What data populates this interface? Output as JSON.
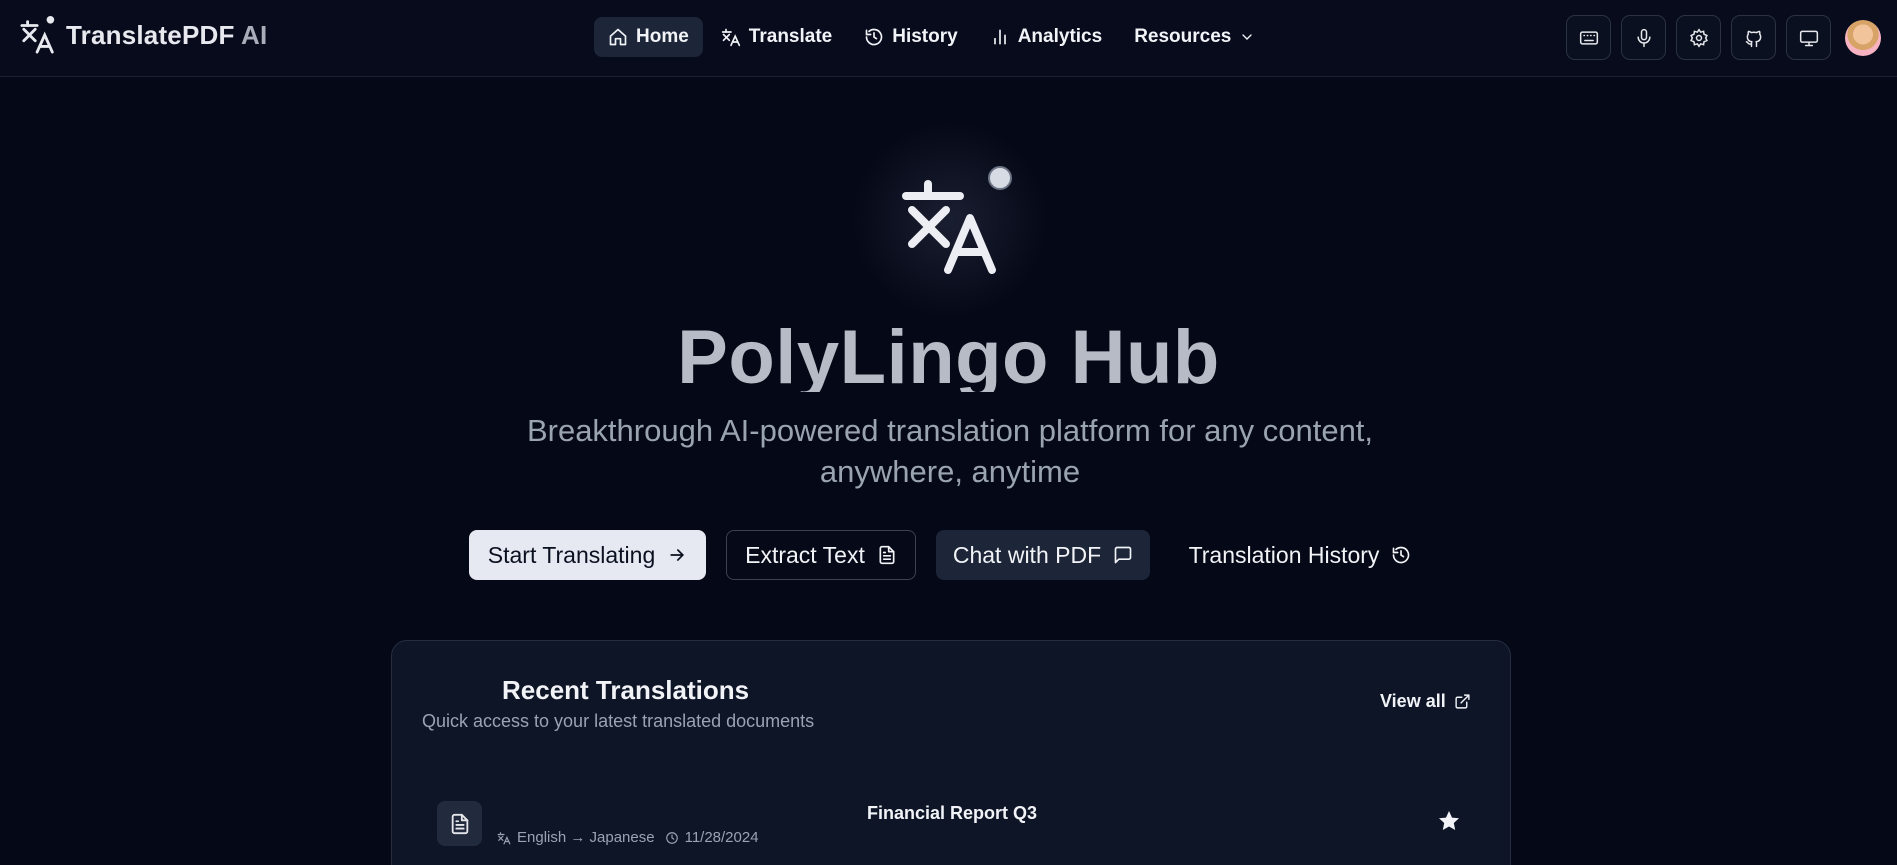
{
  "brand": {
    "name": "TranslatePDF",
    "suffix": " AI",
    "icon": "translate-icon"
  },
  "nav": {
    "items": [
      {
        "label": "Home",
        "icon": "home-icon",
        "active": true
      },
      {
        "label": "Translate",
        "icon": "translate-icon"
      },
      {
        "label": "History",
        "icon": "history-icon"
      },
      {
        "label": "Analytics",
        "icon": "bar-chart-icon"
      },
      {
        "label": "Resources",
        "icon": "chevron-down-icon"
      }
    ]
  },
  "toolbar": {
    "icons": [
      "keyboard-icon",
      "microphone-icon",
      "gear-icon",
      "github-icon",
      "monitor-icon"
    ]
  },
  "hero": {
    "title": "PolyLingo Hub",
    "subtitle": "Breakthrough AI-powered translation platform for any content, anywhere, anytime"
  },
  "actions": {
    "start": "Start Translating",
    "extract": "Extract Text",
    "chat": "Chat with PDF",
    "history": "Translation History"
  },
  "recent": {
    "title": "Recent Translations",
    "subtitle": "Quick access to your latest translated documents",
    "view_all": "View all",
    "items": [
      {
        "title": "Financial Report Q3",
        "languages": "English → Japanese",
        "date": "11/28/2024",
        "starred": true
      }
    ]
  },
  "colors": {
    "background": "#050816",
    "card": "#0e1526",
    "primary_button": "#e6e9f1"
  }
}
